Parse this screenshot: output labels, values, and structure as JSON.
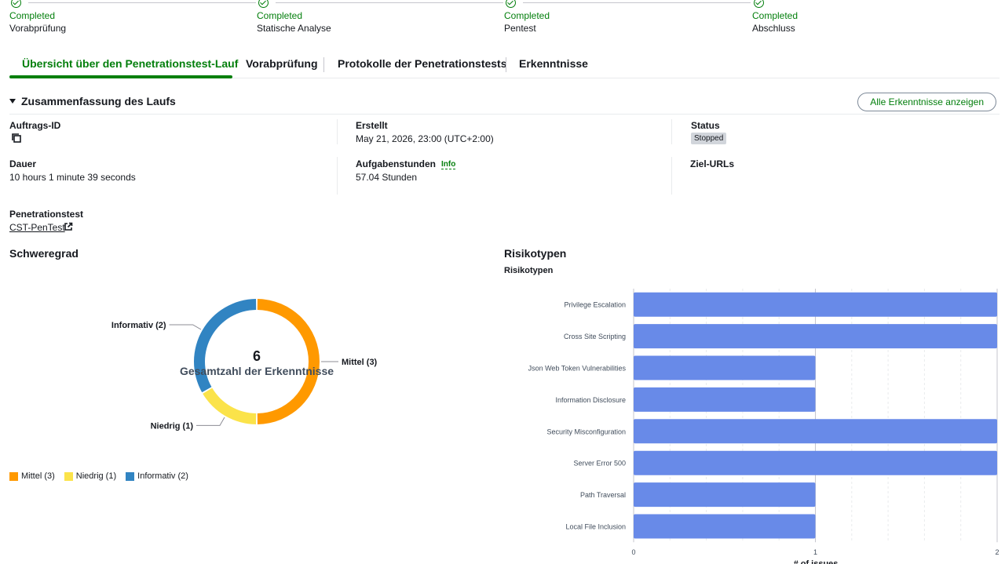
{
  "steps": [
    {
      "status": "Completed",
      "name": "Vorabprüfung"
    },
    {
      "status": "Completed",
      "name": "Statische Analyse"
    },
    {
      "status": "Completed",
      "name": "Pentest"
    },
    {
      "status": "Completed",
      "name": "Abschluss"
    }
  ],
  "tabs": [
    {
      "label": "Übersicht über den Penetrationstest-Lauf"
    },
    {
      "label": "Vorabprüfung"
    },
    {
      "label": "Protokolle der Penetrationstests"
    },
    {
      "label": "Erkenntnisse"
    }
  ],
  "summary": {
    "title": "Zusammenfassung des Laufs",
    "all_findings_button": "Alle Erkenntnisse anzeigen",
    "job_id_label": "Auftrags-ID",
    "created_label": "Erstellt",
    "created_value": "May 21, 2026, 23:00 (UTC+2:00)",
    "status_label": "Status",
    "status_value": "Stopped",
    "duration_label": "Dauer",
    "duration_value": "10 hours 1 minute 39 seconds",
    "task_hours_label": "Aufgabenstunden",
    "info_link": "Info",
    "task_hours_value": "57.04 Stunden",
    "target_urls_label": "Ziel-URLs",
    "pentest_label": "Penetrationstest",
    "pentest_link": "CST-PenTest"
  },
  "severity": {
    "title": "Schweregrad",
    "total": "6",
    "total_label": "Gesamtzahl der Erkenntnisse",
    "slices": [
      {
        "label": "Mittel (3)",
        "value": 3,
        "color": "#ff9900"
      },
      {
        "label": "Niedrig (1)",
        "value": 1,
        "color": "#fbe34a"
      },
      {
        "label": "Informativ (2)",
        "value": 2,
        "color": "#3184c2"
      }
    ]
  },
  "risk": {
    "title": "Risikotypen",
    "subtitle": "Risikotypen"
  },
  "chart_data": [
    {
      "type": "pie",
      "title": "Schweregrad",
      "categories": [
        "Mittel (3)",
        "Niedrig (1)",
        "Informativ (2)"
      ],
      "values": [
        3,
        1,
        2
      ],
      "colors": [
        "#ff9900",
        "#fbe34a",
        "#3184c2"
      ],
      "inner_label": "Gesamtzahl der Erkenntnisse",
      "inner_value": "6",
      "legend": "bottom-left"
    },
    {
      "type": "bar",
      "orientation": "horizontal",
      "title": "Risikotypen",
      "categories": [
        "Privilege Escalation",
        "Cross Site Scripting",
        "Json Web Token Vulnerabilities",
        "Information Disclosure",
        "Security Misconfiguration",
        "Server Error 500",
        "Path Traversal",
        "Local File Inclusion"
      ],
      "values": [
        2,
        2,
        1,
        1,
        2,
        2,
        1,
        1
      ],
      "xlabel": "# of issues",
      "xlim": [
        0,
        2
      ],
      "xticks": [
        "0",
        "1",
        "2"
      ],
      "bar_color": "#688ae8",
      "grid": true
    }
  ]
}
